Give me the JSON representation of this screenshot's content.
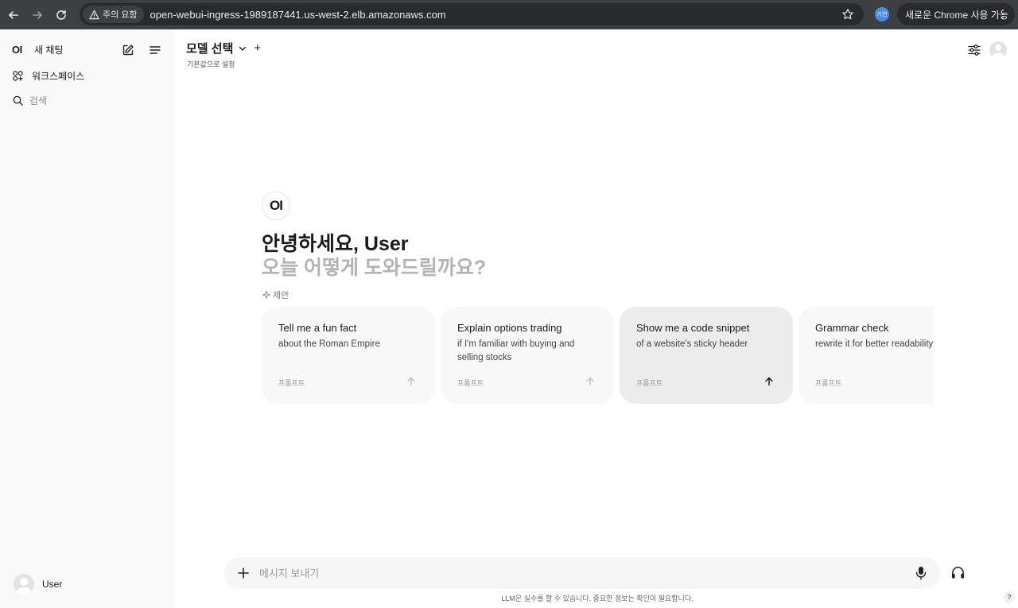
{
  "browser": {
    "warning": "주의 요함",
    "url": "open-webui-ingress-1989187441.us-west-2.elb.amazonaws.com",
    "profile_label": "기연",
    "update_label": "새로운 Chrome 사용 가능"
  },
  "sidebar": {
    "logo": "OI",
    "new_chat": "새 채팅",
    "workspace": "워크스페이스",
    "search": "검색",
    "user_name": "User"
  },
  "header": {
    "model_select": "모델 선택",
    "add": "+",
    "set_default": "기본값으로 설정"
  },
  "main": {
    "logo": "OI",
    "greeting": "안녕하세요, User",
    "subgreeting": "오늘 어떻게 도와드릴까요?",
    "suggestions_label": "제안",
    "cards": [
      {
        "title": "Tell me a fun fact",
        "desc": "about the Roman Empire",
        "prompt": "프롬프트"
      },
      {
        "title": "Explain options trading",
        "desc": "if I'm familiar with buying and selling stocks",
        "prompt": "프롬프트"
      },
      {
        "title": "Show me a code snippet",
        "desc": "of a website's sticky header",
        "prompt": "프롬프트"
      },
      {
        "title": "Grammar check",
        "desc": "rewrite it for better readability",
        "prompt": "프롬프트"
      }
    ]
  },
  "input": {
    "placeholder": "메시지 보내기"
  },
  "footer": {
    "disclaimer": "LLM은 실수를 할 수 있습니다. 중요한 정보는 확인이 필요합니다.",
    "help": "?"
  }
}
